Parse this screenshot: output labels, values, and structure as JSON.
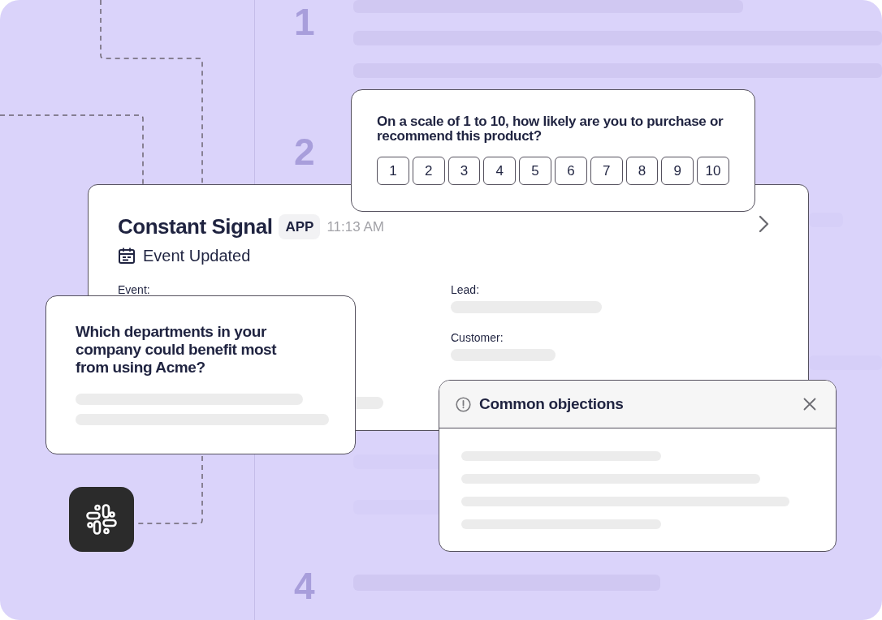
{
  "step_numbers": [
    "1",
    "2",
    "4"
  ],
  "survey_card": {
    "question": "On a scale of 1 to 10, how likely are you to purchase or recommend this product?",
    "scale": [
      "1",
      "2",
      "3",
      "4",
      "5",
      "6",
      "7",
      "8",
      "9",
      "10"
    ]
  },
  "notification_card": {
    "sender": "Constant Signal",
    "badge": "APP",
    "time": "11:13 AM",
    "event": "Event Updated",
    "fields": [
      {
        "label": "Event:"
      },
      {
        "label": "Lead:"
      },
      {
        "label": "Customer:"
      }
    ]
  },
  "question_card": {
    "question": "Which departments in your company could benefit most from using Acme?"
  },
  "objections_card": {
    "title": "Common objections"
  }
}
